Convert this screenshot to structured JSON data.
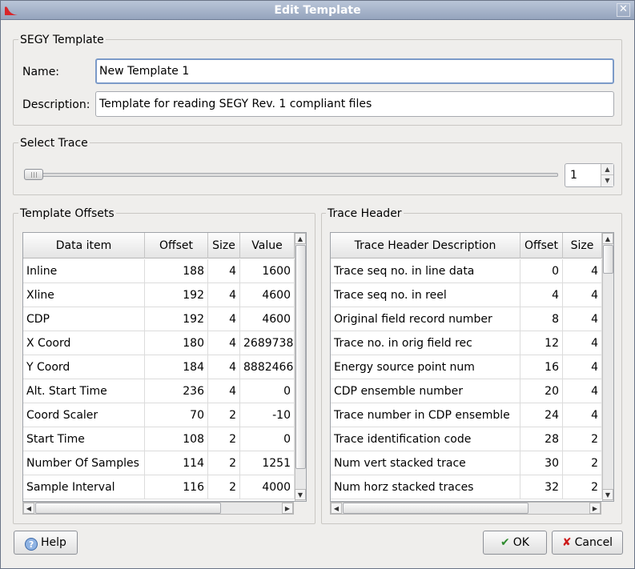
{
  "window": {
    "title": "Edit Template",
    "close_glyph": "✕"
  },
  "segy_template": {
    "group_title": "SEGY Template",
    "name_label": "Name:",
    "name_value": "New Template 1",
    "description_label": "Description:",
    "description_value": "Template for reading SEGY Rev. 1 compliant files"
  },
  "select_trace": {
    "group_title": "Select Trace",
    "slider_value": 1,
    "spin_value": "1",
    "spin_up_glyph": "▲",
    "spin_down_glyph": "▼"
  },
  "template_offsets": {
    "group_title": "Template Offsets",
    "columns": [
      "Data item",
      "Offset",
      "Size",
      "Value"
    ],
    "rows": [
      [
        "Inline",
        "188",
        "4",
        "1600"
      ],
      [
        "Xline",
        "192",
        "4",
        "4600"
      ],
      [
        "CDP",
        "192",
        "4",
        "4600"
      ],
      [
        "X Coord",
        "180",
        "4",
        "2689738"
      ],
      [
        "Y Coord",
        "184",
        "4",
        "8882466"
      ],
      [
        "Alt. Start Time",
        "236",
        "4",
        "0"
      ],
      [
        "Coord Scaler",
        "70",
        "2",
        "-10"
      ],
      [
        "Start Time",
        "108",
        "2",
        "0"
      ],
      [
        "Number Of Samples",
        "114",
        "2",
        "1251"
      ],
      [
        "Sample Interval",
        "116",
        "2",
        "4000"
      ]
    ]
  },
  "trace_header": {
    "group_title": "Trace Header",
    "columns": [
      "Trace Header Description",
      "Offset",
      "Size"
    ],
    "rows": [
      [
        "Trace seq no. in line data",
        "0",
        "4"
      ],
      [
        "Trace seq no. in reel",
        "4",
        "4"
      ],
      [
        "Original field record number",
        "8",
        "4"
      ],
      [
        "Trace no. in orig field rec",
        "12",
        "4"
      ],
      [
        "Energy source point num",
        "16",
        "4"
      ],
      [
        "CDP ensemble number",
        "20",
        "4"
      ],
      [
        "Trace number in CDP ensemble",
        "24",
        "4"
      ],
      [
        "Trace identification code",
        "28",
        "2"
      ],
      [
        "Num vert stacked trace",
        "30",
        "2"
      ],
      [
        "Num horz stacked traces",
        "32",
        "2"
      ]
    ]
  },
  "scroll_glyphs": {
    "up": "▲",
    "down": "▼",
    "left": "◀",
    "right": "▶"
  },
  "buttons": {
    "help_label": "Help",
    "help_icon": "?",
    "ok_label": "OK",
    "ok_icon": "✔",
    "cancel_label": "Cancel",
    "cancel_icon": "✘"
  },
  "colors": {
    "ok_icon": "#2e8b2e",
    "cancel_icon": "#cc1a1a",
    "help_icon": "#5b8ccf",
    "titlebar": "#a8b6cc"
  }
}
